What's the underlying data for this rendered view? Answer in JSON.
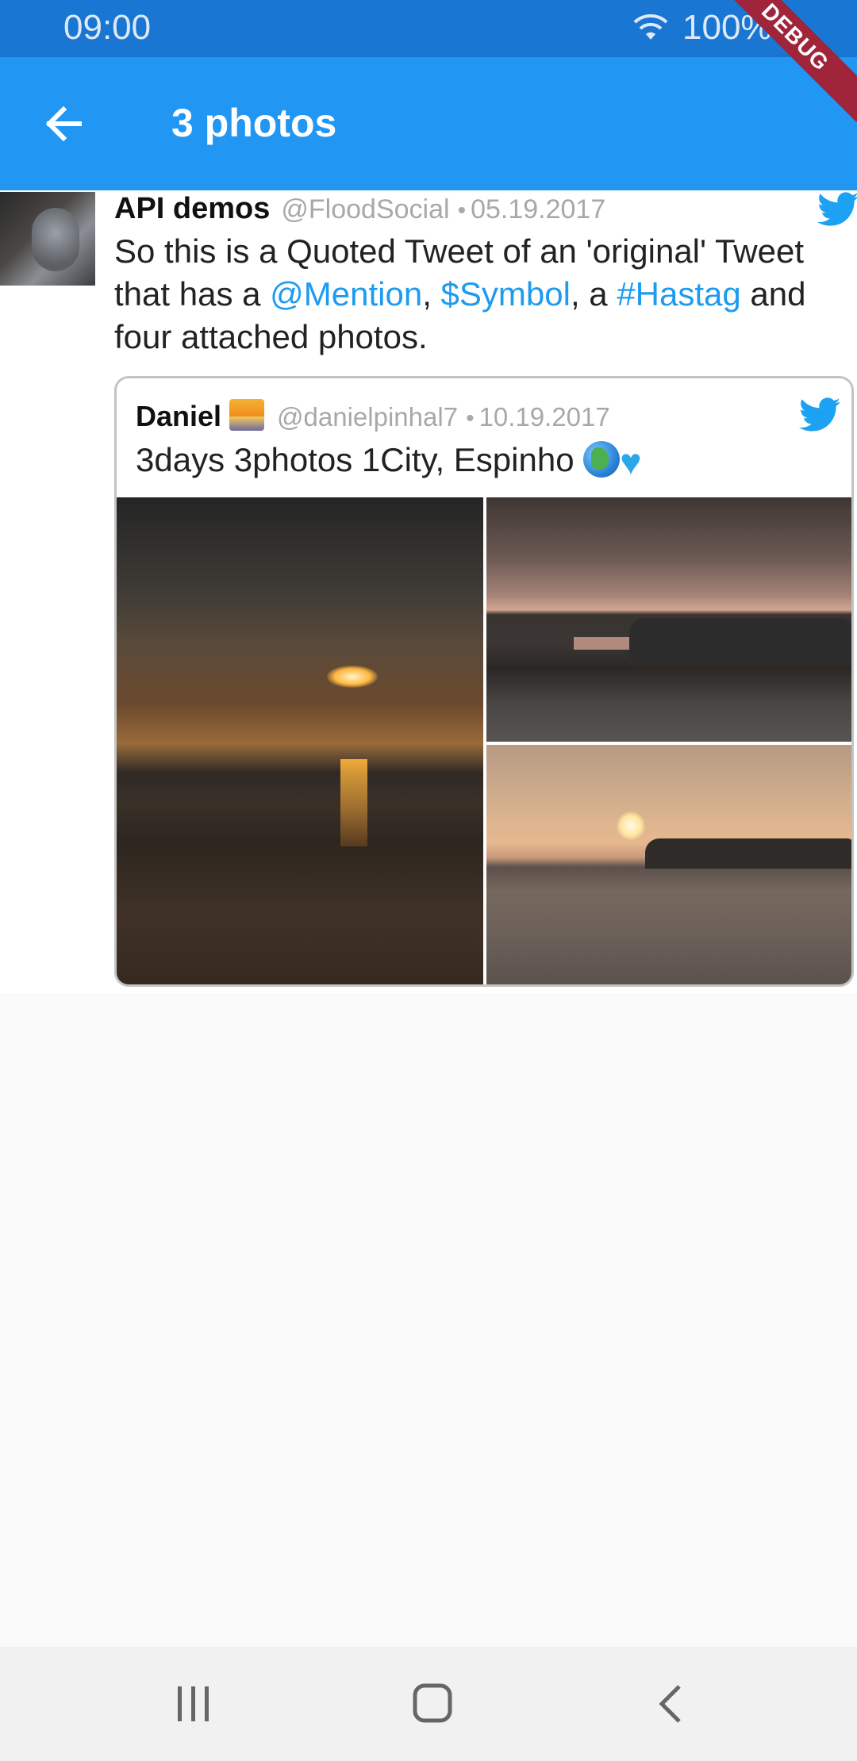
{
  "status_bar": {
    "time": "09:00",
    "battery": "100%",
    "icons": [
      "wifi-icon",
      "battery-icon"
    ]
  },
  "debug_banner": "DEBUG",
  "app_bar": {
    "title": "3 photos",
    "back_icon": "arrow-back-icon",
    "color": "#2196f3",
    "status_color": "#1976d2"
  },
  "tweet": {
    "name": "API demos",
    "handle": "@FloodSocial",
    "separator": "•",
    "date": "05.19.2017",
    "text_parts": {
      "p1": "So this is a Quoted Tweet of an 'original' Tweet that has a ",
      "mention": "@Mention",
      "p2": ",  ",
      "symbol": "$Symbol",
      "p3": ", a ",
      "hashtag": "#Hastag",
      "p4": " and four attached photos."
    },
    "link_color": "#1d9bf0",
    "bird_icon": "twitter-bird-icon"
  },
  "quoted_tweet": {
    "name": "Daniel",
    "name_emoji": "sunrise-icon",
    "handle": "@danielpinhal7",
    "separator": "•",
    "date": "10.19.2017",
    "text": "3days 3photos 1City, Espinho ",
    "emojis": [
      "globe-icon",
      "blue-heart-icon"
    ],
    "photos": [
      "beach-sunset-photo",
      "fisherman-rocks-photo",
      "sunset-jetty-photo"
    ]
  },
  "nav_bar": {
    "icons": [
      "recents-icon",
      "home-icon",
      "back-icon"
    ]
  }
}
